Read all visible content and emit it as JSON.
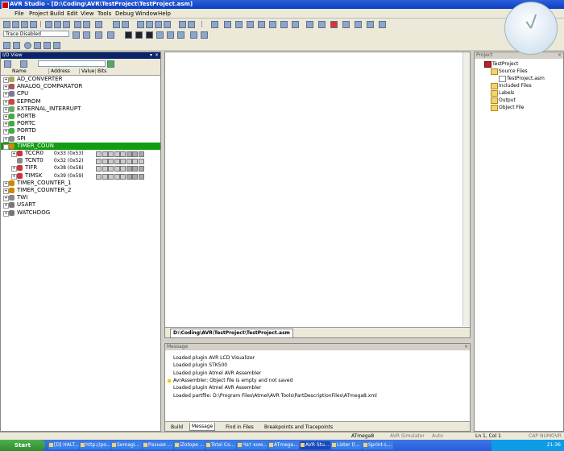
{
  "window": {
    "title": "AVR Studio - [D:\\Coding\\AVR\\TestProject\\TestProject.asm]"
  },
  "menu": [
    "File",
    "Project",
    "Build",
    "Edit",
    "View",
    "Tools",
    "Debug",
    "Window",
    "Help"
  ],
  "toolbar": {
    "trace_select": "Trace Disabled"
  },
  "io_view": {
    "title": "I/O View",
    "columns": [
      "Name",
      "Address",
      "Value",
      "Bits"
    ],
    "items": [
      {
        "name": "AD_CONVERTER",
        "expander": "+"
      },
      {
        "name": "ANALOG_COMPARATOR",
        "expander": "+"
      },
      {
        "name": "CPU",
        "expander": "+"
      },
      {
        "name": "EEPROM",
        "expander": "+"
      },
      {
        "name": "EXTERNAL_INTERRUPT",
        "expander": "+"
      },
      {
        "name": "PORTB",
        "expander": "+"
      },
      {
        "name": "PORTC",
        "expander": "+"
      },
      {
        "name": "PORTD",
        "expander": "+"
      },
      {
        "name": "SPI",
        "expander": "+"
      },
      {
        "name": "TIMER_COUN",
        "expander": "-"
      },
      {
        "name": "TCCR0",
        "expander": "+",
        "address": "0x33 (0x53)"
      },
      {
        "name": "TCNT0",
        "expander": "",
        "address": "0x32 (0x52)"
      },
      {
        "name": "TIFR",
        "expander": "+",
        "address": "0x38 (0x58)"
      },
      {
        "name": "TIMSK",
        "expander": "+",
        "address": "0x39 (0x59)"
      },
      {
        "name": "TIMER_COUNTER_1",
        "expander": "+"
      },
      {
        "name": "TIMER_COUNTER_2",
        "expander": "+"
      },
      {
        "name": "TWI",
        "expander": "+"
      },
      {
        "name": "USART",
        "expander": "+"
      },
      {
        "name": "WATCHDOG",
        "expander": "+"
      }
    ]
  },
  "editor": {
    "tab_label": "D:\\Coding\\AVR\\TestProject\\TestProject.asm"
  },
  "message": {
    "title": "Message",
    "lines": [
      {
        "text": "Loaded plugin AVR LCD Visualizer",
        "warn": false
      },
      {
        "text": "Loaded plugin STK500",
        "warn": false
      },
      {
        "text": "Loaded plugin Atmel AVR Assembler",
        "warn": false
      },
      {
        "text": "AvrAssembler: Object file is empty and not saved",
        "warn": true
      },
      {
        "text": "Loaded plugin Atmel AVR Assembler",
        "warn": false
      },
      {
        "text": "Loaded partfile: D:\\Program Files\\Atmel\\AVR Tools\\PartDescriptionFiles\\ATmega8.xml",
        "warn": false
      }
    ],
    "tabs": [
      "Build",
      "Message",
      "Find in Files",
      "Breakpoints and Tracepoints"
    ]
  },
  "project": {
    "title": "Project",
    "tree": [
      "TestProject",
      "Source Files",
      "TestProject.asm",
      "Included Files",
      "Labels",
      "Output",
      "Object File"
    ]
  },
  "status": {
    "device": "ATmega8",
    "simulator": "AVR Simulator",
    "mode": "Auto",
    "position": "Ln 1, Col 1",
    "cap": "CAP",
    "num": "NUM",
    "ovr": "OVR"
  },
  "taskbar": {
    "start": "Start",
    "tasks": [
      "[D] HALT...",
      "http://po...",
      "Semagi...",
      "Разная ...",
      "iZotope ...",
      "Total Co...",
      "Чат ком...",
      "ATmega...",
      "AVR Stu...",
      "Lister (l...",
      "Sprint-L..."
    ],
    "active_index": 8,
    "clock": "21:36"
  }
}
